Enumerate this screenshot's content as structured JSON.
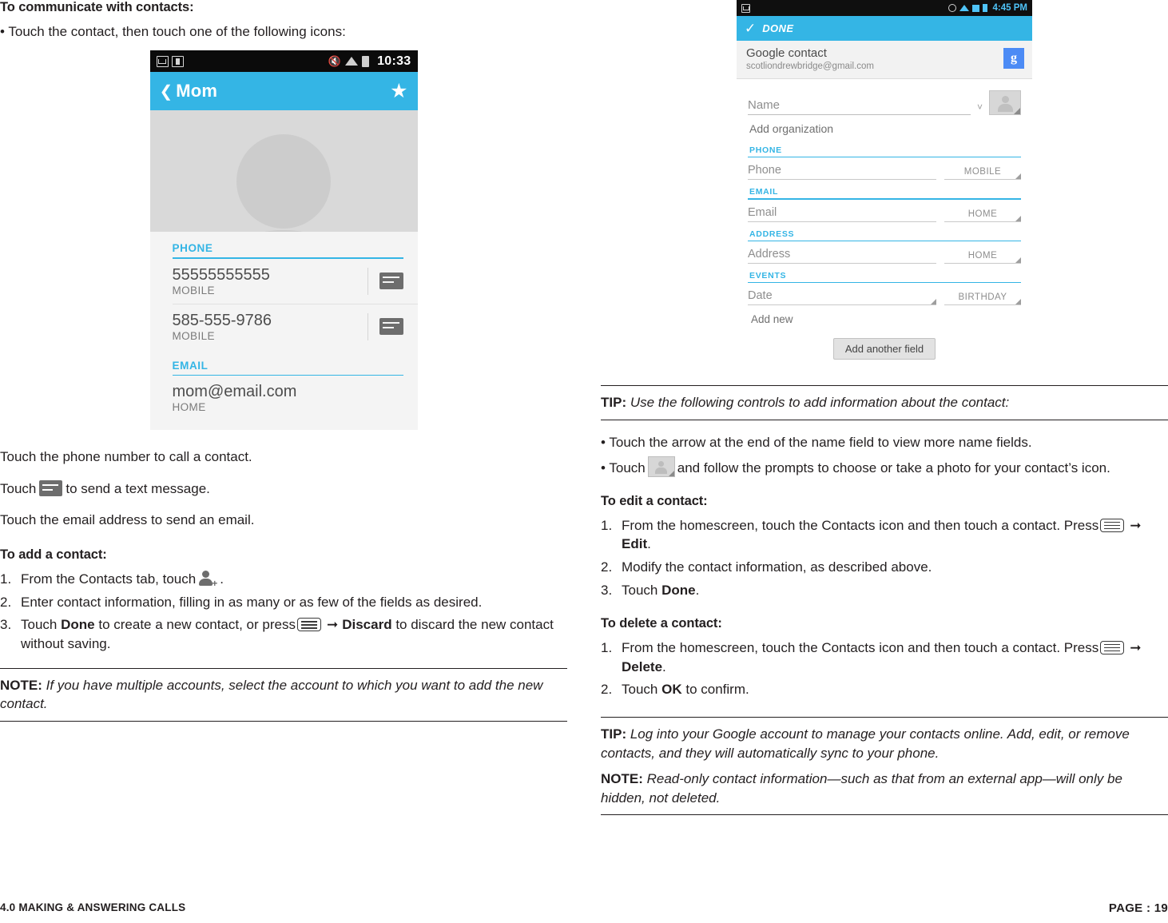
{
  "left": {
    "heading": "To communicate with contacts:",
    "bullet1": "• Touch the contact, then touch one of the following icons:",
    "phone1": {
      "status_time": "10:33",
      "title": "Mom",
      "sections": {
        "phone_label": "PHONE",
        "email_label": "EMAIL"
      },
      "rows": [
        {
          "value": "55555555555",
          "sub": "MOBILE"
        },
        {
          "value": "585-555-9786",
          "sub": "MOBILE"
        }
      ],
      "email": {
        "value": "mom@email.com",
        "sub": "HOME"
      }
    },
    "p_call": "Touch the phone number to call a contact.",
    "p_text_a": "Touch",
    "p_text_b": "to send a text message.",
    "p_email": "Touch the email address to send an email.",
    "add_heading": "To add a contact:",
    "add_steps": [
      {
        "num": "1.",
        "pre": "From the Contacts tab, touch",
        "post": "."
      },
      {
        "num": "2.",
        "text": "Enter contact information, filling in as many or as few of the fields as desired."
      },
      {
        "num": "3.",
        "pre": "Touch",
        "bold1": "Done",
        "mid": "to create a new contact, or press",
        "bold2": "Discard",
        "post": "to discard the new contact without saving."
      }
    ],
    "note": {
      "label": "NOTE:",
      "text": "If you have multiple accounts, select the account to which you want to add the new contact."
    }
  },
  "right": {
    "phone2": {
      "status_time": "4:45 PM",
      "done_label": "DONE",
      "account_name": "Google contact",
      "account_email": "scotliondrewbridge@gmail.com",
      "account_badge": "g",
      "name_field": "Name",
      "add_organization": "Add organization",
      "sections": [
        {
          "label": "PHONE",
          "field": "Phone",
          "tag": "MOBILE"
        },
        {
          "label": "EMAIL",
          "field": "Email",
          "tag": "HOME"
        },
        {
          "label": "ADDRESS",
          "field": "Address",
          "tag": "HOME"
        },
        {
          "label": "EVENTS",
          "field": "Date",
          "tag": "BIRTHDAY"
        }
      ],
      "add_new": "Add new",
      "add_another_field": "Add another field"
    },
    "tip1": {
      "label": "TIP:",
      "text": "Use the following controls to add information about the contact:"
    },
    "bullet1": "• Touch the arrow at the end of the name field to view more name fields.",
    "bullet2_a": "• Touch",
    "bullet2_b": "and follow the prompts to choose or take a photo for your contact’s icon.",
    "edit_heading": "To edit a contact:",
    "edit_steps": [
      {
        "num": "1.",
        "pre": "From the homescreen, touch the Contacts icon and then touch a contact. Press",
        "bold": "Edit",
        "post": "."
      },
      {
        "num": "2.",
        "text": "Modify the contact information, as described above."
      },
      {
        "num": "3.",
        "pre": "Touch",
        "bold": "Done",
        "post": "."
      }
    ],
    "delete_heading": "To delete a contact:",
    "delete_steps": [
      {
        "num": "1.",
        "pre": "From the homescreen, touch the Contacts icon and then touch a contact. Press",
        "bold": "Delete",
        "post": "."
      },
      {
        "num": "2.",
        "pre": "Touch",
        "bold": "OK",
        "post": "to confirm."
      }
    ],
    "tip2": {
      "label": "TIP:",
      "text": "Log into your Google account to manage your contacts online. Add, edit, or remove contacts, and they will automatically sync to your phone."
    },
    "note2": {
      "label": "NOTE:",
      "text": "Read-only contact information—such as that from an external app—will only be hidden, not deleted."
    }
  },
  "footer": {
    "section": "4.0 MAKING & ANSWERING CALLS",
    "page": "PAGE : 19"
  }
}
